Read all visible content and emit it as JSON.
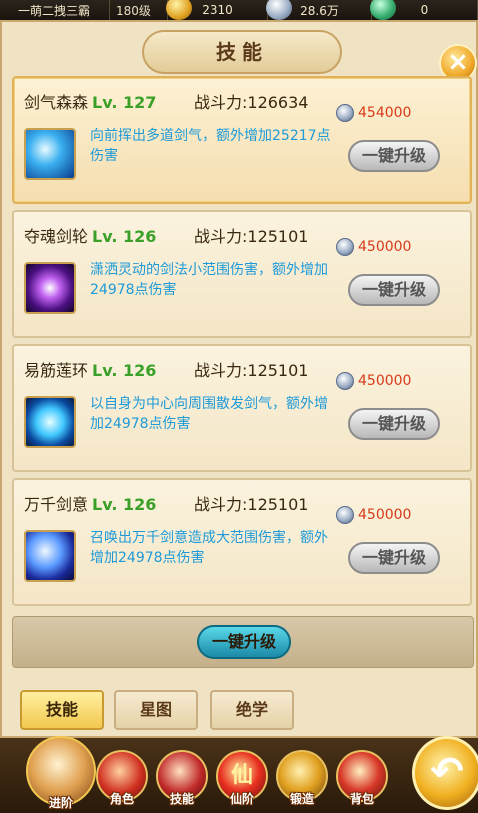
{
  "topbar": {
    "player_name": "一萌二拽三霸",
    "level": "180级",
    "gold": "2310",
    "silver": "28.6万",
    "jade": "0"
  },
  "panel": {
    "title": "技能",
    "close_icon": "×"
  },
  "skills": [
    {
      "name": "剑气森森",
      "level": "Lv. 127",
      "power": "战斗力:126634",
      "cost": "454000",
      "description": "向前挥出多道剑气，额外增加25217点伤害",
      "button": "一键升级",
      "icon": "sword-qi-skill-icon"
    },
    {
      "name": "夺魂剑轮",
      "level": "Lv. 126",
      "power": "战斗力:125101",
      "cost": "450000",
      "description": "潇洒灵动的剑法小范围伤害，额外增加24978点伤害",
      "button": "一键升级",
      "icon": "soul-wheel-skill-icon"
    },
    {
      "name": "易筋莲环",
      "level": "Lv. 126",
      "power": "战斗力:125101",
      "cost": "450000",
      "description": "以自身为中心向周围散发剑气，额外增加24978点伤害",
      "button": "一键升级",
      "icon": "lotus-ring-skill-icon"
    },
    {
      "name": "万千剑意",
      "level": "Lv. 126",
      "power": "战斗力:125101",
      "cost": "450000",
      "description": "召唤出万千剑意造成大范围伤害，额外增加24978点伤害",
      "button": "一键升级",
      "icon": "myriad-sword-skill-icon"
    }
  ],
  "all_upgrade_label": "一键升级",
  "tabs": [
    "技能",
    "星图",
    "绝学"
  ],
  "nav": {
    "advance": "进阶",
    "role": "角色",
    "skill": "技能",
    "xian_rank": "仙阶",
    "forge": "锻造",
    "bag": "背包",
    "xian_glyph": "仙",
    "return_icon": "↶"
  },
  "colors": {
    "skill_level": "#3aa028",
    "description": "#1e9ad8",
    "cost": "#d83a1a",
    "all_upgrade_button": "#1a8aa8"
  }
}
